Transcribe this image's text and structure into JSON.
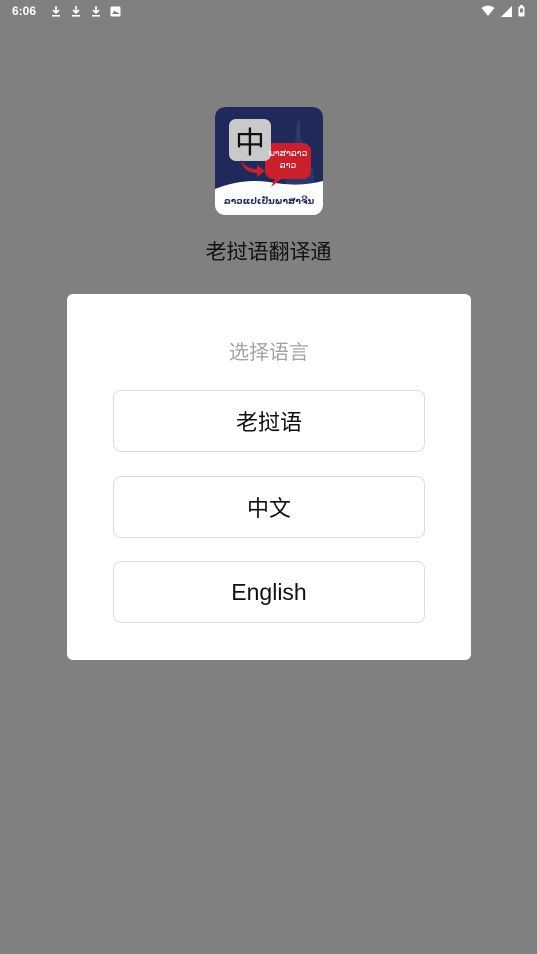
{
  "status_bar": {
    "time": "6:06",
    "left_icons": [
      "download-icon",
      "download-icon",
      "download-icon",
      "image-icon"
    ],
    "right_icons": [
      "wifi-icon",
      "signal-icon",
      "battery-icon"
    ]
  },
  "app": {
    "icon_char": "中",
    "icon_bubble_text_line1": "ພາສາລາວ",
    "icon_bubble_text_line2": "ລາວ",
    "icon_caption": "ລາວແປເປັນພາສາຈີນ",
    "title": "老挝语翻译通"
  },
  "dialog": {
    "title": "选择语言",
    "options": [
      {
        "label": "老挝语"
      },
      {
        "label": "中文"
      },
      {
        "label": "English"
      }
    ]
  },
  "colors": {
    "overlay_bg": "#808080",
    "dialog_bg": "#ffffff",
    "dialog_title": "#a3a3a3",
    "icon_navy": "#1f2a5a",
    "icon_red": "#c8202d"
  }
}
